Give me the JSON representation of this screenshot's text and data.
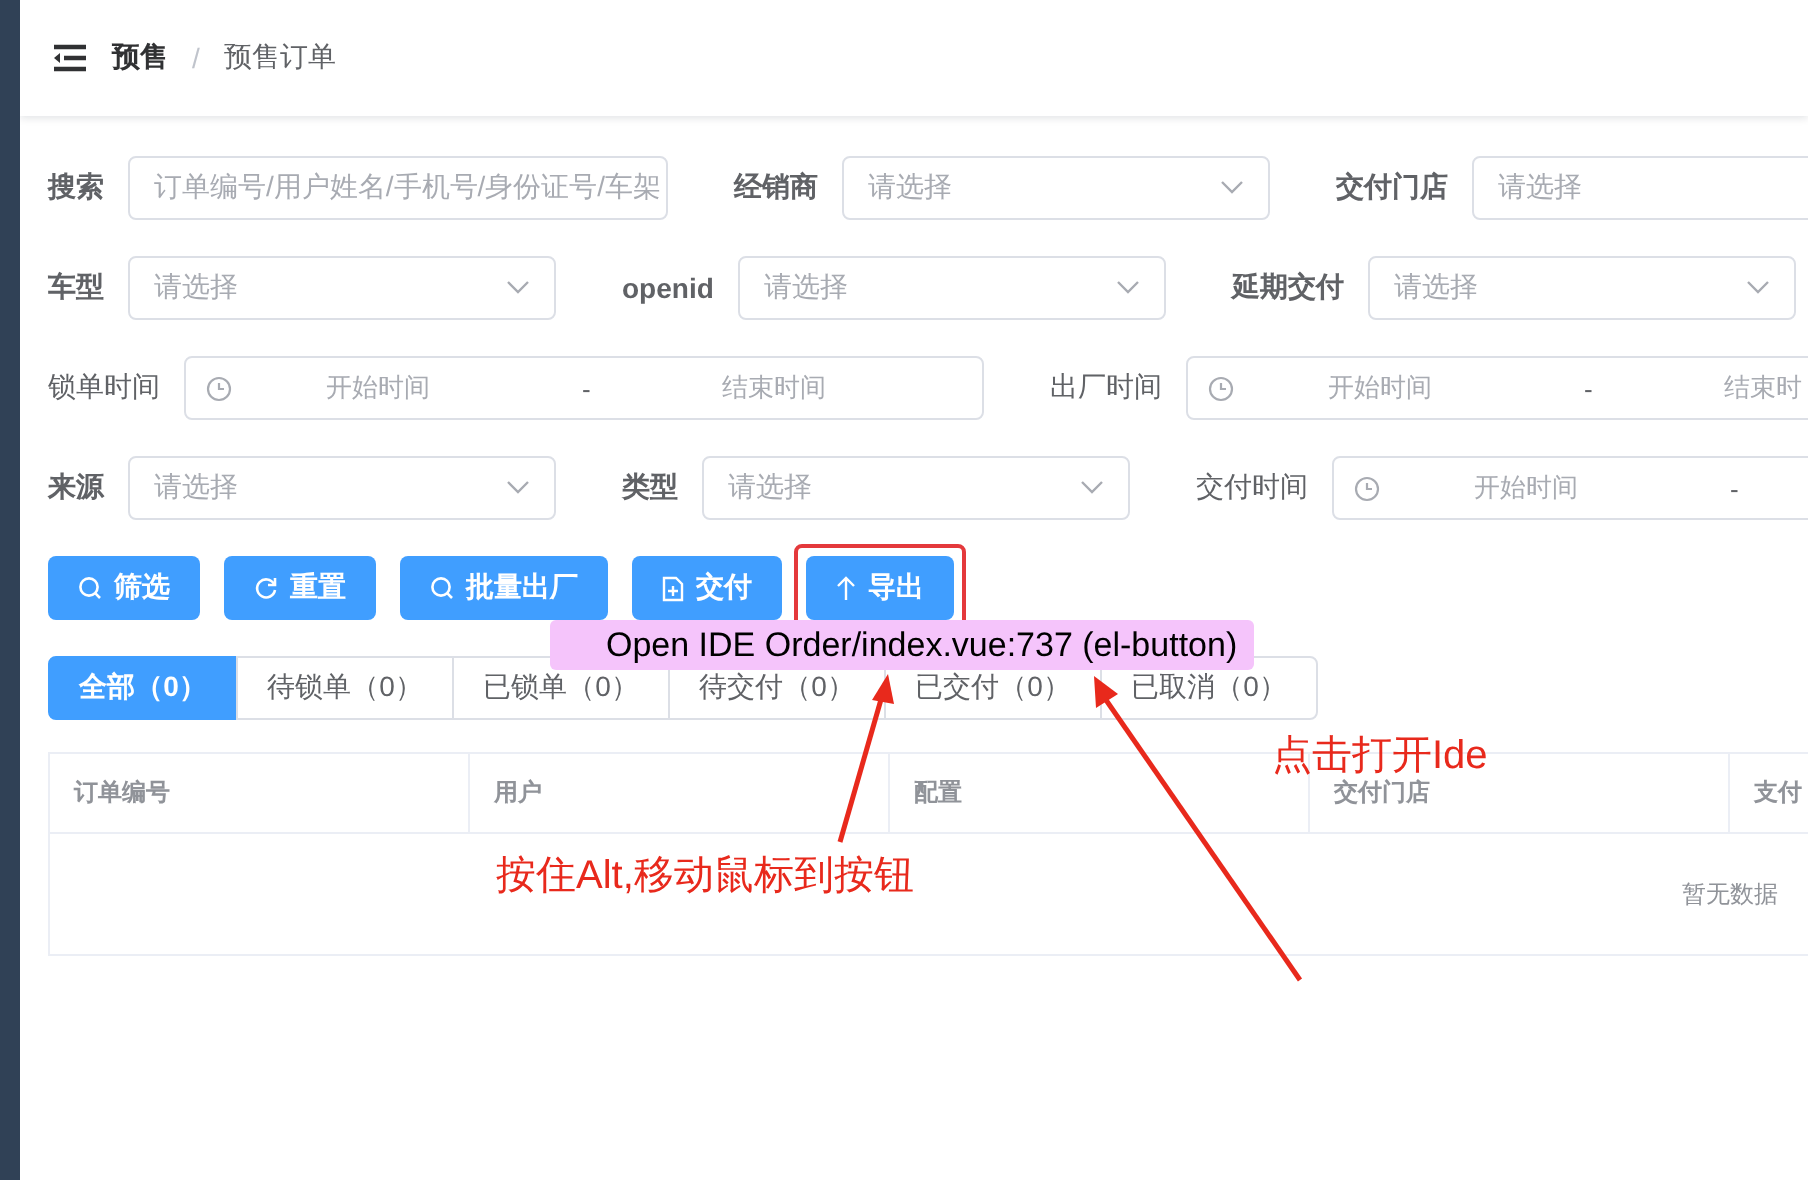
{
  "breadcrumb": {
    "parent": "预售",
    "separator": "/",
    "current": "预售订单"
  },
  "filters": [
    [
      {
        "label": "搜索",
        "kind": "input",
        "placeholder": "订单编号/用户姓名/手机号/身份证号/车架"
      },
      {
        "label": "经销商",
        "kind": "select",
        "placeholder": "请选择"
      },
      {
        "label": "交付门店",
        "kind": "input",
        "placeholder": "请选择"
      }
    ],
    [
      {
        "label": "车型",
        "kind": "select",
        "placeholder": "请选择"
      },
      {
        "label": "openid",
        "kind": "select",
        "placeholder": "请选择"
      },
      {
        "label": "延期交付",
        "kind": "select",
        "placeholder": "请选择"
      }
    ],
    [
      {
        "label": "锁单时间",
        "kind": "range",
        "start": "开始时间",
        "separator": "-",
        "end": "结束时间"
      },
      {
        "label": "出厂时间",
        "kind": "range",
        "start": "开始时间",
        "separator": "-",
        "end": "结束时"
      }
    ],
    [
      {
        "label": "来源",
        "kind": "select",
        "placeholder": "请选择"
      },
      {
        "label": "类型",
        "kind": "select",
        "placeholder": "请选择"
      },
      {
        "label": "交付时间",
        "kind": "range",
        "start": "开始时间",
        "separator": "-"
      }
    ]
  ],
  "buttons": [
    {
      "label": "筛选",
      "highlighted": false
    },
    {
      "label": "重置",
      "highlighted": false
    },
    {
      "label": "批量出厂",
      "highlighted": false
    },
    {
      "label": "交付",
      "highlighted": false
    },
    {
      "label": "导出",
      "highlighted": true
    }
  ],
  "tabs": [
    {
      "label": "全部（0）",
      "selected": true
    },
    {
      "label": "待锁单（0）",
      "selected": false
    },
    {
      "label": "已锁单（0）",
      "selected": false
    },
    {
      "label": "待交付（0）",
      "selected": false
    },
    {
      "label": "已交付（0）",
      "selected": false
    },
    {
      "label": "已取消（0）",
      "selected": false
    }
  ],
  "table": {
    "columns": [
      "订单编号",
      "用户",
      "配置",
      "交付门店",
      "支付"
    ],
    "empty_text": "暂无数据"
  },
  "tooltip": "Open IDE Order/index.vue:737 (el-button)",
  "annotations": [
    "按住Alt,移动鼠标到按钮",
    "点击打开Ide"
  ]
}
